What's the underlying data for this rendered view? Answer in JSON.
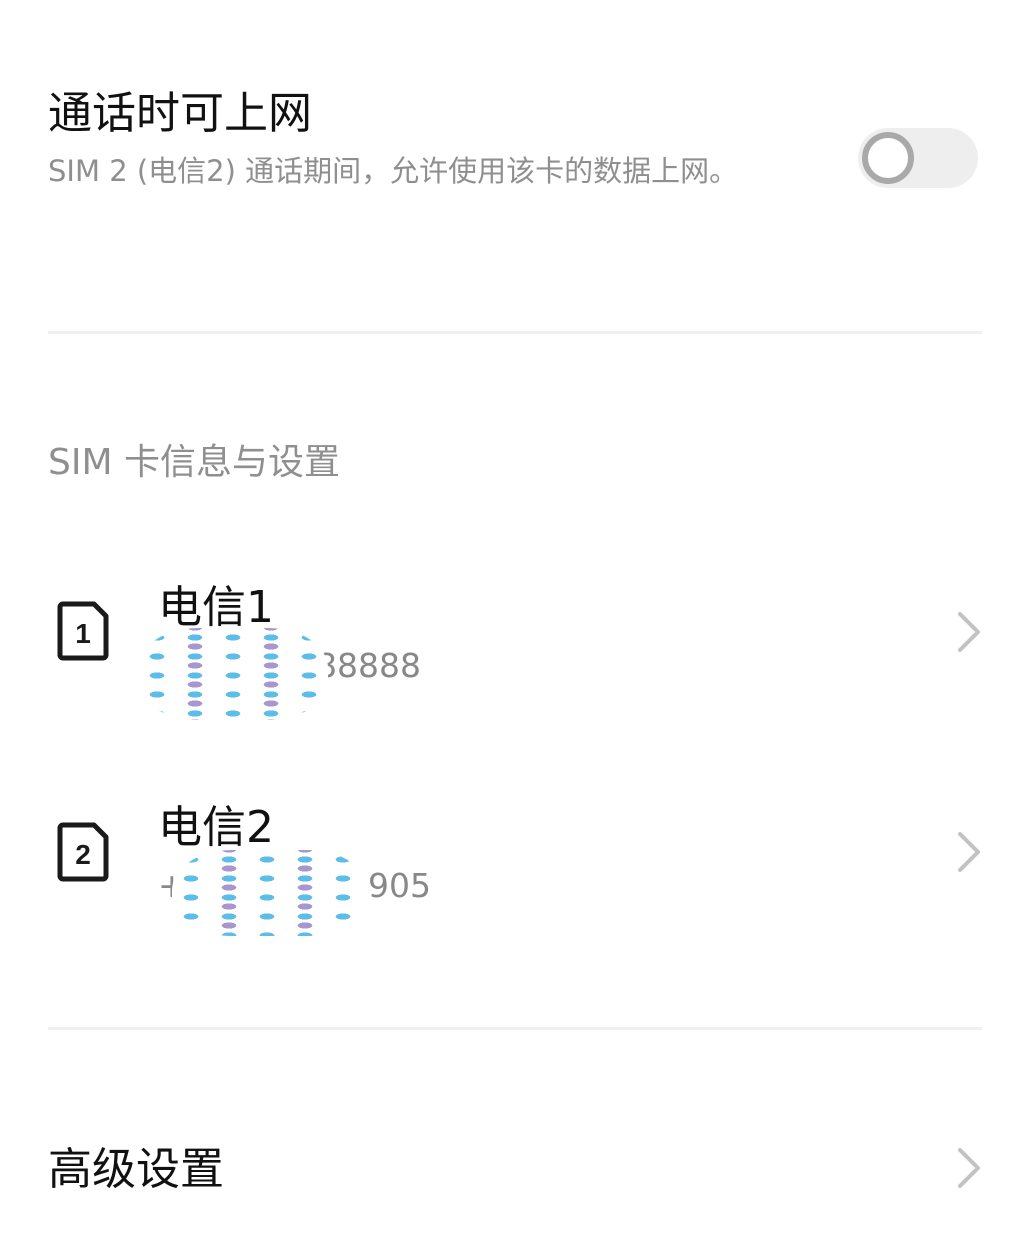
{
  "data_while_calling": {
    "title": "通话时可上网",
    "description": "SIM 2 (电信2) 通话期间，允许使用该卡的数据上网。",
    "enabled": false
  },
  "sim_section": {
    "header": "SIM 卡信息与设置",
    "cards": [
      {
        "slot": "1",
        "name": "电信1",
        "number_visible": "88888",
        "icon": "sim-card-1-icon"
      },
      {
        "slot": "2",
        "name": "电信2",
        "number_prefix": "+",
        "number_visible": "905",
        "icon": "sim-card-2-icon"
      }
    ]
  },
  "advanced": {
    "label": "高级设置"
  },
  "colors": {
    "title_text": "#111111",
    "secondary_text": "#8f8f8f",
    "divider": "#f0f0f0",
    "switch_track_off": "#eeeeee",
    "switch_knob_ring": "#a9a9a9",
    "chevron": "#c2c2c2"
  }
}
